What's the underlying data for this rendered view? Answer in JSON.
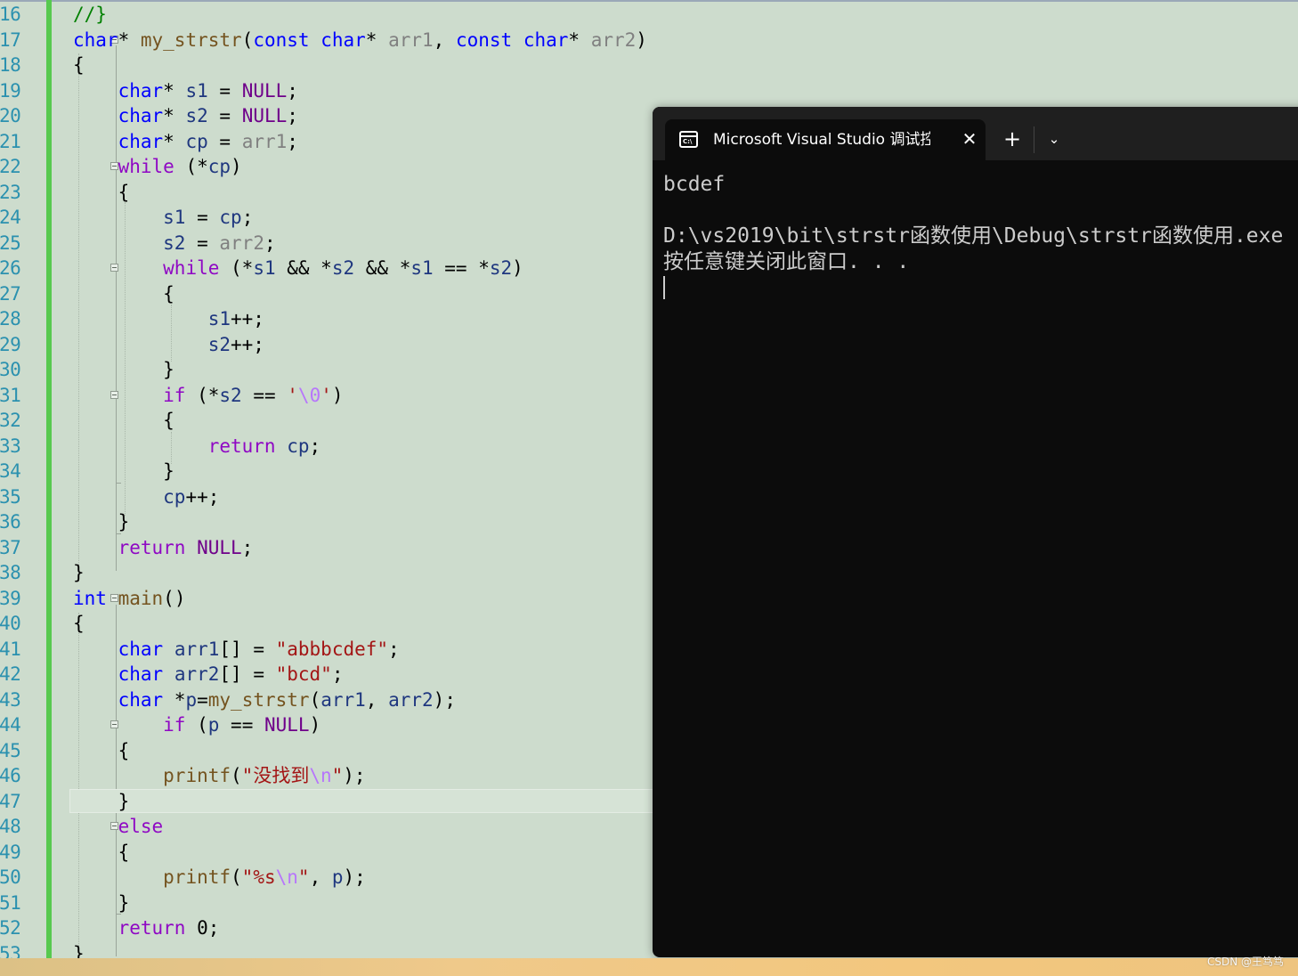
{
  "editor": {
    "line_numbers": [
      "16",
      "17",
      "18",
      "19",
      "20",
      "21",
      "22",
      "23",
      "24",
      "25",
      "26",
      "27",
      "28",
      "29",
      "30",
      "31",
      "32",
      "33",
      "34",
      "35",
      "36",
      "37",
      "38",
      "39",
      "40",
      "41",
      "42",
      "43",
      "44",
      "45",
      "46",
      "47",
      "48",
      "49",
      "50",
      "51",
      "52",
      "53"
    ],
    "lines": [
      [
        [
          "//}",
          "c"
        ]
      ],
      [
        [
          "char",
          "k"
        ],
        [
          "* ",
          "n"
        ],
        [
          "my_strstr",
          "f"
        ],
        [
          "(",
          "n"
        ],
        [
          "const",
          "k"
        ],
        [
          " ",
          "n"
        ],
        [
          "char",
          "k"
        ],
        [
          "* ",
          "n"
        ],
        [
          "arr1",
          "pr"
        ],
        [
          ", ",
          "n"
        ],
        [
          "const",
          "k"
        ],
        [
          " ",
          "n"
        ],
        [
          "char",
          "k"
        ],
        [
          "* ",
          "n"
        ],
        [
          "arr2",
          "pr"
        ],
        [
          ")",
          "n"
        ]
      ],
      [
        [
          "{",
          "n"
        ]
      ],
      [
        [
          "    ",
          "n"
        ],
        [
          "char",
          "k"
        ],
        [
          "* ",
          "n"
        ],
        [
          "s1",
          "l"
        ],
        [
          " = ",
          "n"
        ],
        [
          "NULL",
          "m"
        ],
        [
          ";",
          "n"
        ]
      ],
      [
        [
          "    ",
          "n"
        ],
        [
          "char",
          "k"
        ],
        [
          "* ",
          "n"
        ],
        [
          "s2",
          "l"
        ],
        [
          " = ",
          "n"
        ],
        [
          "NULL",
          "m"
        ],
        [
          ";",
          "n"
        ]
      ],
      [
        [
          "    ",
          "n"
        ],
        [
          "char",
          "k"
        ],
        [
          "* ",
          "n"
        ],
        [
          "cp",
          "l"
        ],
        [
          " = ",
          "n"
        ],
        [
          "arr1",
          "pr"
        ],
        [
          ";",
          "n"
        ]
      ],
      [
        [
          "    ",
          "n"
        ],
        [
          "while",
          "p"
        ],
        [
          " (*",
          "n"
        ],
        [
          "cp",
          "l"
        ],
        [
          ")",
          "n"
        ]
      ],
      [
        [
          "    {",
          "n"
        ]
      ],
      [
        [
          "        ",
          "n"
        ],
        [
          "s1",
          "l"
        ],
        [
          " = ",
          "n"
        ],
        [
          "cp",
          "l"
        ],
        [
          ";",
          "n"
        ]
      ],
      [
        [
          "        ",
          "n"
        ],
        [
          "s2",
          "l"
        ],
        [
          " = ",
          "n"
        ],
        [
          "arr2",
          "pr"
        ],
        [
          ";",
          "n"
        ]
      ],
      [
        [
          "        ",
          "n"
        ],
        [
          "while",
          "p"
        ],
        [
          " (*",
          "n"
        ],
        [
          "s1",
          "l"
        ],
        [
          " && *",
          "n"
        ],
        [
          "s2",
          "l"
        ],
        [
          " && *",
          "n"
        ],
        [
          "s1",
          "l"
        ],
        [
          " == *",
          "n"
        ],
        [
          "s2",
          "l"
        ],
        [
          ")",
          "n"
        ]
      ],
      [
        [
          "        {",
          "n"
        ]
      ],
      [
        [
          "            ",
          "n"
        ],
        [
          "s1",
          "l"
        ],
        [
          "++;",
          "n"
        ]
      ],
      [
        [
          "            ",
          "n"
        ],
        [
          "s2",
          "l"
        ],
        [
          "++;",
          "n"
        ]
      ],
      [
        [
          "        }",
          "n"
        ]
      ],
      [
        [
          "        ",
          "n"
        ],
        [
          "if",
          "p"
        ],
        [
          " (*",
          "n"
        ],
        [
          "s2",
          "l"
        ],
        [
          " == ",
          "n"
        ],
        [
          "'",
          "s"
        ],
        [
          "\\0",
          "e"
        ],
        [
          "'",
          "s"
        ],
        [
          ")",
          "n"
        ]
      ],
      [
        [
          "        {",
          "n"
        ]
      ],
      [
        [
          "            ",
          "n"
        ],
        [
          "return",
          "p"
        ],
        [
          " ",
          "n"
        ],
        [
          "cp",
          "l"
        ],
        [
          ";",
          "n"
        ]
      ],
      [
        [
          "        }",
          "n"
        ]
      ],
      [
        [
          "        ",
          "n"
        ],
        [
          "cp",
          "l"
        ],
        [
          "++;",
          "n"
        ]
      ],
      [
        [
          "    }",
          "n"
        ]
      ],
      [
        [
          "    ",
          "n"
        ],
        [
          "return",
          "p"
        ],
        [
          " ",
          "n"
        ],
        [
          "NULL",
          "m"
        ],
        [
          ";",
          "n"
        ]
      ],
      [
        [
          "}",
          "n"
        ]
      ],
      [
        [
          "int",
          "k"
        ],
        [
          " ",
          "n"
        ],
        [
          "main",
          "f"
        ],
        [
          "()",
          "n"
        ]
      ],
      [
        [
          "{",
          "n"
        ]
      ],
      [
        [
          "    ",
          "n"
        ],
        [
          "char",
          "k"
        ],
        [
          " ",
          "n"
        ],
        [
          "arr1",
          "l"
        ],
        [
          "[] = ",
          "n"
        ],
        [
          "\"abbbcdef\"",
          "s"
        ],
        [
          ";",
          "n"
        ]
      ],
      [
        [
          "    ",
          "n"
        ],
        [
          "char",
          "k"
        ],
        [
          " ",
          "n"
        ],
        [
          "arr2",
          "l"
        ],
        [
          "[] = ",
          "n"
        ],
        [
          "\"bcd\"",
          "s"
        ],
        [
          ";",
          "n"
        ]
      ],
      [
        [
          "    ",
          "n"
        ],
        [
          "char",
          "k"
        ],
        [
          " *",
          "n"
        ],
        [
          "p",
          "l"
        ],
        [
          "=",
          "n"
        ],
        [
          "my_strstr",
          "f"
        ],
        [
          "(",
          "n"
        ],
        [
          "arr1",
          "l"
        ],
        [
          ", ",
          "n"
        ],
        [
          "arr2",
          "l"
        ],
        [
          ");",
          "n"
        ]
      ],
      [
        [
          "        ",
          "n"
        ],
        [
          "if",
          "p"
        ],
        [
          " (",
          "n"
        ],
        [
          "p",
          "l"
        ],
        [
          " == ",
          "n"
        ],
        [
          "NULL",
          "m"
        ],
        [
          ")",
          "n"
        ]
      ],
      [
        [
          "    {",
          "n"
        ]
      ],
      [
        [
          "        ",
          "n"
        ],
        [
          "printf",
          "f"
        ],
        [
          "(",
          "n"
        ],
        [
          "\"没找到",
          "s"
        ],
        [
          "\\n",
          "e"
        ],
        [
          "\"",
          "s"
        ],
        [
          ");",
          "n"
        ]
      ],
      [
        [
          "    }",
          "n"
        ]
      ],
      [
        [
          "    ",
          "n"
        ],
        [
          "else",
          "p"
        ]
      ],
      [
        [
          "    {",
          "n"
        ]
      ],
      [
        [
          "        ",
          "n"
        ],
        [
          "printf",
          "f"
        ],
        [
          "(",
          "n"
        ],
        [
          "\"%s",
          "s"
        ],
        [
          "\\n",
          "e"
        ],
        [
          "\"",
          "s"
        ],
        [
          ", ",
          "n"
        ],
        [
          "p",
          "l"
        ],
        [
          ");",
          "n"
        ]
      ],
      [
        [
          "    }",
          "n"
        ]
      ],
      [
        [
          "    ",
          "n"
        ],
        [
          "return",
          "p"
        ],
        [
          " 0;",
          "n"
        ]
      ],
      [
        [
          "}",
          "n"
        ]
      ]
    ]
  },
  "console": {
    "tab_title": "Microsoft Visual Studio 调试控制台",
    "icon_glyph": "C:\\",
    "close_glyph": "✕",
    "new_tab_glyph": "+",
    "dropdown_glyph": "⌄",
    "output": [
      "bcdef",
      "",
      "D:\\vs2019\\bit\\strstr函数使用\\Debug\\strstr函数使用.exe",
      "按任意键关闭此窗口. . ."
    ]
  },
  "watermark": "CSDN @王笃笃",
  "colors": {
    "editor_background": "#cddccd",
    "line_number": "#2b91af",
    "keyword": "#0000ff",
    "control_keyword": "#8f08c4",
    "function": "#74531f",
    "string": "#a31515",
    "console_background": "#0c0c0c"
  }
}
